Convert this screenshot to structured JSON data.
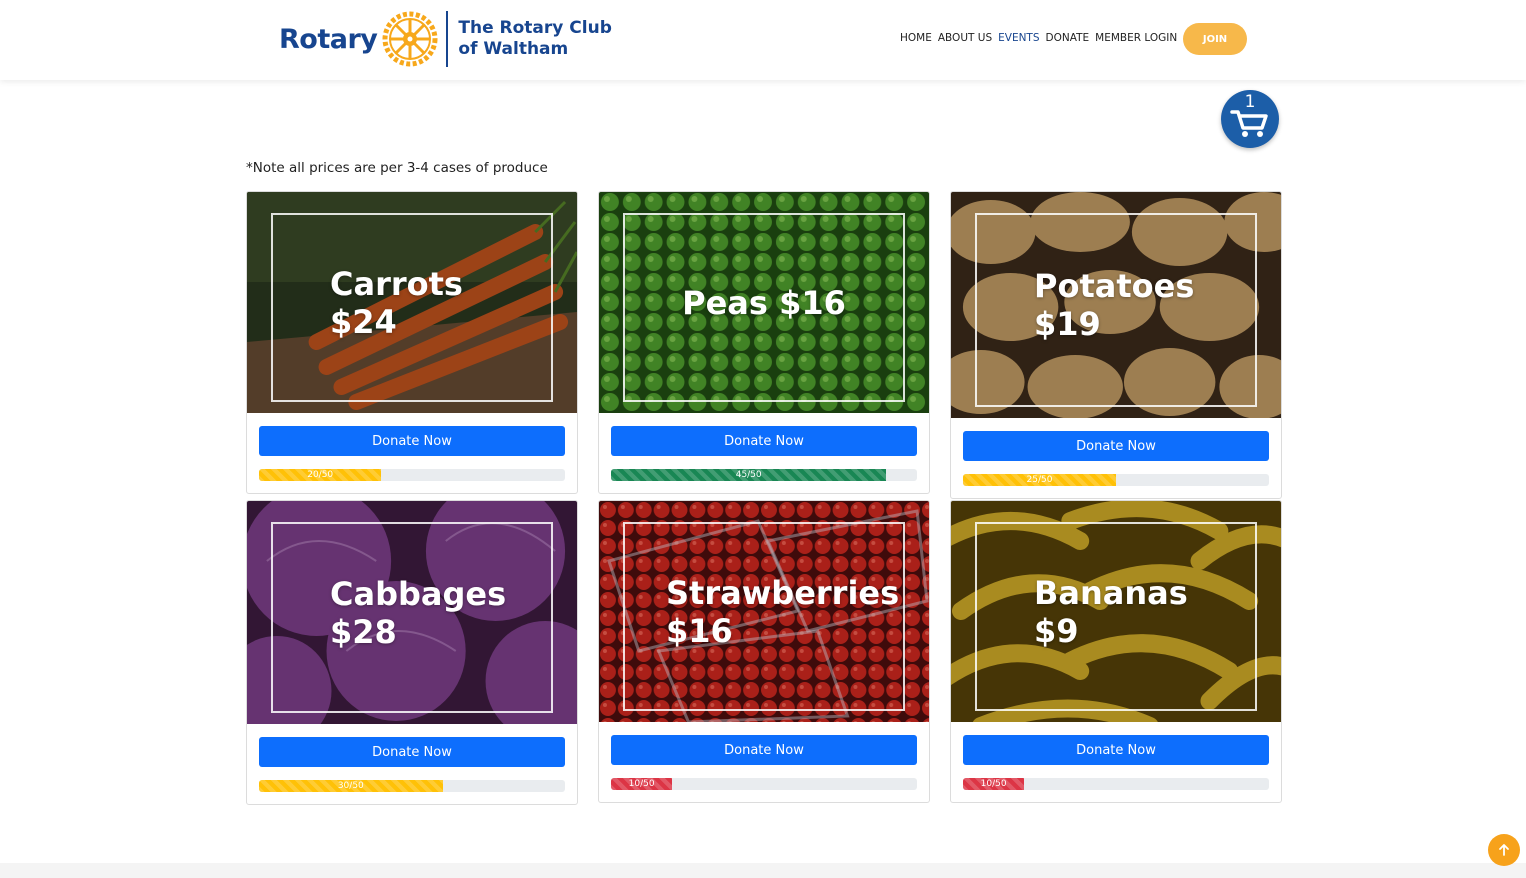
{
  "brand": {
    "logo_word": "Rotary",
    "club_line1": "The Rotary Club",
    "club_line2": "of Waltham",
    "colors": {
      "blue": "#17458f",
      "gold": "#f7a81b"
    }
  },
  "nav": {
    "items": [
      {
        "label": "HOME"
      },
      {
        "label": "ABOUT US"
      },
      {
        "label": "EVENTS",
        "active": true
      },
      {
        "label": "DONATE"
      },
      {
        "label": "MEMBER LOGIN"
      }
    ],
    "join_label": "JOIN"
  },
  "cart": {
    "count": "1",
    "icon": "shopping-cart-icon"
  },
  "note": "*Note all prices are per 3-4 cases of produce",
  "donate_label": "Donate Now",
  "products": [
    {
      "name": "Carrots",
      "price": "$24",
      "progress_text": "20/50",
      "progress": 0.4,
      "bar_color": "#ffc107"
    },
    {
      "name": "Peas",
      "price": "$16",
      "progress_text": "45/50",
      "progress": 0.9,
      "bar_color": "#198754"
    },
    {
      "name": "Potatoes",
      "price": "$19",
      "progress_text": "25/50",
      "progress": 0.5,
      "bar_color": "#ffc107"
    },
    {
      "name": "Cabbages",
      "price": "$28",
      "progress_text": "30/50",
      "progress": 0.6,
      "bar_color": "#ffc107"
    },
    {
      "name": "Strawberries",
      "price": "$16",
      "progress_text": "10/50",
      "progress": 0.2,
      "bar_color": "#dc3545"
    },
    {
      "name": "Bananas",
      "price": "$9",
      "progress_text": "10/50",
      "progress": 0.2,
      "bar_color": "#dc3545"
    }
  ],
  "scroll_top_icon": "arrow-up-icon"
}
